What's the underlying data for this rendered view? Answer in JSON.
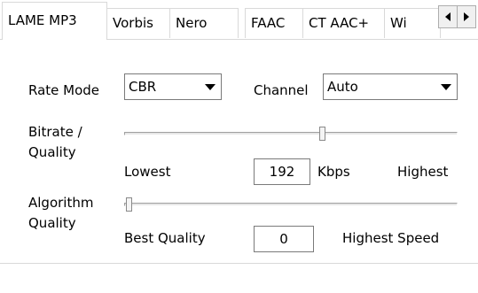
{
  "tabs": [
    "LAME MP3",
    "Vorbis",
    "Nero",
    "FAAC",
    "CT AAC+",
    "Wi"
  ],
  "rate_mode": {
    "label": "Rate Mode",
    "value": "CBR"
  },
  "channel": {
    "label": "Channel",
    "value": "Auto"
  },
  "bitrate": {
    "label_line1": "Bitrate /",
    "label_line2": "Quality",
    "min_label": "Lowest",
    "max_label": "Highest",
    "value": "192",
    "unit": "Kbps",
    "slider_fraction": 0.6
  },
  "algorithm": {
    "label_line1": "Algorithm",
    "label_line2": "Quality",
    "min_label": "Best Quality",
    "max_label": "Highest Speed",
    "value": "0",
    "slider_fraction": 0.0
  }
}
